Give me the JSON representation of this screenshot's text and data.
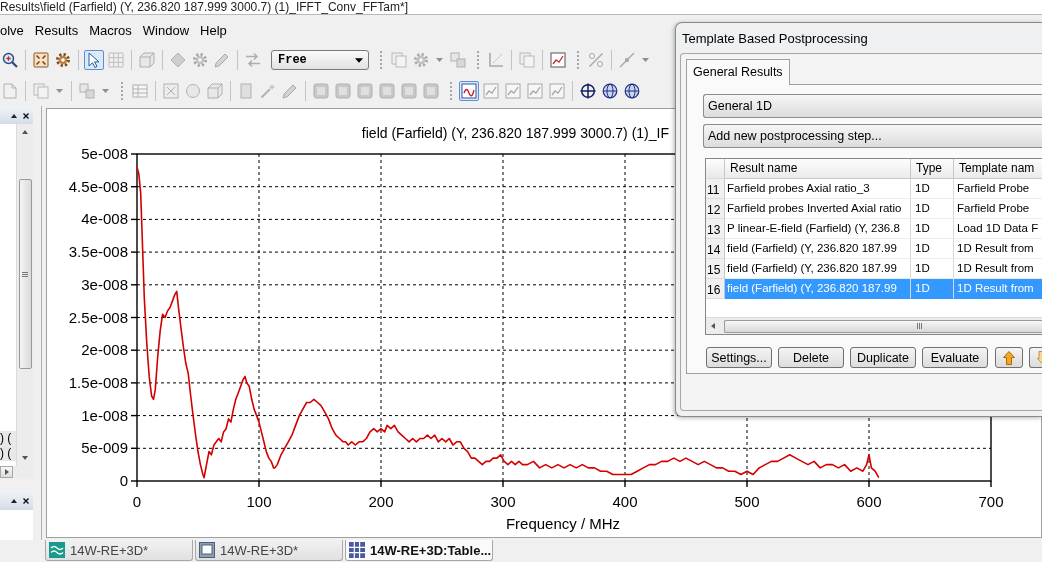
{
  "title_bar": {
    "title": "Results\\field (Farfield) (Y, 236.820 187.999 3000.7) (1)_IFFT_Conv_FFTam*]"
  },
  "menu": [
    "olve",
    "Results",
    "Macros",
    "Window",
    "Help"
  ],
  "toolbars": [
    [
      {
        "kind": "zoom",
        "disabled": false,
        "on": false
      },
      {
        "kind": "separator"
      },
      {
        "kind": "fit",
        "disabled": false,
        "on": false
      },
      {
        "kind": "wheel",
        "disabled": false,
        "on": false
      },
      {
        "kind": "separator"
      },
      {
        "kind": "pointer",
        "disabled": false,
        "on": true
      },
      {
        "kind": "grid",
        "disabled": true,
        "on": false
      },
      {
        "kind": "separator"
      },
      {
        "kind": "cube",
        "disabled": true,
        "on": false
      },
      {
        "kind": "separator"
      },
      {
        "kind": "diamond",
        "disabled": true,
        "on": false
      },
      {
        "kind": "wheel",
        "disabled": true,
        "on": false
      },
      {
        "kind": "pencil",
        "disabled": true,
        "on": false
      },
      {
        "kind": "separator"
      },
      {
        "kind": "arrows",
        "disabled": true,
        "on": false
      },
      {
        "kind": "dropdown",
        "value": "Free"
      },
      {
        "kind": "handle"
      },
      {
        "kind": "pages",
        "disabled": true,
        "on": false
      },
      {
        "kind": "wheel",
        "disabled": true,
        "on": false
      },
      {
        "kind": "caret",
        "disabled": true
      },
      {
        "kind": "squares",
        "disabled": true,
        "on": false
      },
      {
        "kind": "handle"
      },
      {
        "kind": "axes",
        "disabled": true,
        "on": false
      },
      {
        "kind": "separator"
      },
      {
        "kind": "pages",
        "disabled": true,
        "on": false
      },
      {
        "kind": "separator"
      },
      {
        "kind": "chart",
        "disabled": false,
        "on": false
      },
      {
        "kind": "handle"
      },
      {
        "kind": "percent",
        "disabled": true,
        "on": false
      },
      {
        "kind": "separator"
      },
      {
        "kind": "line",
        "disabled": true,
        "on": false
      },
      {
        "kind": "caret",
        "disabled": true
      }
    ],
    [
      {
        "kind": "page",
        "disabled": true,
        "on": false
      },
      {
        "kind": "separator"
      },
      {
        "kind": "pages",
        "disabled": true,
        "on": false
      },
      {
        "kind": "caret",
        "disabled": true
      },
      {
        "kind": "separator"
      },
      {
        "kind": "squares",
        "disabled": true,
        "on": false
      },
      {
        "kind": "caret",
        "disabled": true
      },
      {
        "kind": "handle"
      },
      {
        "kind": "table",
        "disabled": true,
        "on": false
      },
      {
        "kind": "separator"
      },
      {
        "kind": "crossed",
        "disabled": true,
        "on": false
      },
      {
        "kind": "circle",
        "disabled": true,
        "on": false
      },
      {
        "kind": "cube",
        "disabled": true,
        "on": false
      },
      {
        "kind": "separator"
      },
      {
        "kind": "rectangle",
        "disabled": true,
        "on": false
      },
      {
        "kind": "wand",
        "disabled": true,
        "on": false
      },
      {
        "kind": "pencil",
        "disabled": true,
        "on": false
      },
      {
        "kind": "separator"
      },
      {
        "kind": "tile",
        "disabled": true,
        "on": false
      },
      {
        "kind": "tile",
        "disabled": true,
        "on": false
      },
      {
        "kind": "tile",
        "disabled": true,
        "on": false
      },
      {
        "kind": "tile",
        "disabled": true,
        "on": false
      },
      {
        "kind": "tile",
        "disabled": true,
        "on": false
      },
      {
        "kind": "tile",
        "disabled": true,
        "on": false
      },
      {
        "kind": "handle"
      },
      {
        "kind": "wave",
        "disabled": false,
        "on": true
      },
      {
        "kind": "chart",
        "disabled": true,
        "on": false
      },
      {
        "kind": "chart",
        "disabled": true,
        "on": false
      },
      {
        "kind": "chart",
        "disabled": true,
        "on": false
      },
      {
        "kind": "chart",
        "disabled": true,
        "on": false
      },
      {
        "kind": "separator"
      },
      {
        "kind": "crosshair",
        "disabled": false,
        "on": false
      },
      {
        "kind": "globe",
        "disabled": false,
        "on": false
      },
      {
        "kind": "globe",
        "disabled": false,
        "on": false
      }
    ]
  ],
  "left_panel": {
    "items": [
      ") (",
      ") ("
    ]
  },
  "plot": {
    "chart_data": {
      "type": "line",
      "title": "field (Farfield) (Y, 236.820 187.999 3000.7) (1)_IF",
      "xlabel": "Frequency / MHz",
      "grid": true,
      "xlim": [
        0,
        700
      ],
      "ylim": [
        0,
        5e-08
      ],
      "xticks": [
        0,
        100,
        200,
        300,
        400,
        500,
        600,
        700
      ],
      "yticks": [
        {
          "value": 0,
          "label": "0"
        },
        {
          "value": 5e-09,
          "label": "5e-009"
        },
        {
          "value": 1e-08,
          "label": "1e-008"
        },
        {
          "value": 1.5e-08,
          "label": "1.5e-008"
        },
        {
          "value": 2e-08,
          "label": "2e-008"
        },
        {
          "value": 2.5e-08,
          "label": "2.5e-008"
        },
        {
          "value": 3e-08,
          "label": "3e-008"
        },
        {
          "value": 3.5e-08,
          "label": "3.5e-008"
        },
        {
          "value": 4e-08,
          "label": "4e-008"
        },
        {
          "value": 4.5e-08,
          "label": "4.5e-008"
        },
        {
          "value": 5e-08,
          "label": "5e-008"
        }
      ],
      "x": [
        0,
        1.5,
        3,
        4.5,
        6,
        8,
        10,
        12,
        13.5,
        15,
        17,
        19,
        21,
        23,
        25,
        27,
        29,
        31,
        32.5,
        34,
        36,
        38,
        40,
        42,
        44,
        46,
        48,
        50,
        52,
        54,
        55,
        57,
        59,
        61,
        63,
        65,
        67,
        69,
        71,
        73,
        75,
        77,
        79,
        81,
        83,
        85,
        87,
        88.5,
        90,
        92,
        94,
        96,
        98,
        100,
        102,
        104,
        106,
        108,
        110,
        112,
        113,
        115,
        118,
        121,
        124,
        127,
        130,
        133,
        136,
        139,
        142,
        145,
        148,
        151,
        154,
        157,
        160,
        163,
        166,
        169,
        171,
        173,
        176,
        179,
        182,
        185,
        188,
        191,
        194,
        197,
        200,
        203,
        205,
        208,
        211,
        214,
        217,
        220,
        223,
        226,
        229,
        232,
        235,
        238,
        241,
        244,
        247,
        250,
        253,
        256,
        259,
        262,
        265,
        268,
        271,
        274,
        277,
        280,
        283,
        286,
        289,
        292,
        295,
        298,
        301,
        304,
        307,
        310,
        313,
        316,
        320,
        325,
        330,
        335,
        340,
        345,
        350,
        355,
        360,
        365,
        370,
        375,
        380,
        385,
        390,
        395,
        400,
        405,
        410,
        415,
        420,
        425,
        430,
        435,
        440,
        445,
        450,
        455,
        460,
        465,
        470,
        475,
        480,
        485,
        490,
        495,
        500,
        505,
        510,
        515,
        520,
        525,
        530,
        535,
        540,
        545,
        550,
        555,
        560,
        565,
        570,
        575,
        580,
        585,
        590,
        595,
        598,
        600,
        602,
        605,
        608
      ],
      "series": [
        {
          "color": "#d40000",
          "values": [
            4.8e-08,
            4.7e-08,
            4.4e-08,
            3.6e-08,
            2.8e-08,
            2.1e-08,
            1.6e-08,
            1.3e-08,
            1.25e-08,
            1.4e-08,
            1.9e-08,
            2.3e-08,
            2.55e-08,
            2.5e-08,
            2.6e-08,
            2.65e-08,
            2.75e-08,
            2.85e-08,
            2.9e-08,
            2.65e-08,
            2.35e-08,
            2.05e-08,
            1.8e-08,
            1.65e-08,
            1.3e-08,
            1e-08,
            7e-09,
            4.5e-09,
            2.5e-09,
            1e-09,
            5e-10,
            2.5e-09,
            4.5e-09,
            4e-09,
            5.5e-09,
            6e-09,
            6.5e-09,
            6e-09,
            7.5e-09,
            8e-09,
            9.5e-09,
            9e-09,
            1.1e-08,
            1.25e-08,
            1.35e-08,
            1.45e-08,
            1.55e-08,
            1.6e-08,
            1.5e-08,
            1.45e-08,
            1.25e-08,
            1.1e-08,
            1e-08,
            9e-09,
            7.5e-09,
            6e-09,
            4.5e-09,
            3.5e-09,
            3e-09,
            2e-09,
            2e-09,
            2.5e-09,
            4e-09,
            5e-09,
            6e-09,
            7e-09,
            8.5e-09,
            1e-08,
            1.1e-08,
            1.2e-08,
            1.2e-08,
            1.25e-08,
            1.2e-08,
            1.15e-08,
            1.05e-08,
            9.5e-09,
            8e-09,
            7e-09,
            6.5e-09,
            6e-09,
            6e-09,
            5.5e-09,
            6e-09,
            5.5e-09,
            6e-09,
            6e-09,
            6.5e-09,
            7.5e-09,
            8e-09,
            7.5e-09,
            8e-09,
            7.5e-09,
            8.5e-09,
            8e-09,
            8.5e-09,
            7.5e-09,
            7e-09,
            6.5e-09,
            6e-09,
            6.5e-09,
            6e-09,
            6.5e-09,
            6.5e-09,
            7e-09,
            6.5e-09,
            7e-09,
            6e-09,
            6.5e-09,
            6e-09,
            6.5e-09,
            5.5e-09,
            6e-09,
            6e-09,
            5e-09,
            4.5e-09,
            3.5e-09,
            3.5e-09,
            3e-09,
            2.5e-09,
            3e-09,
            3e-09,
            3.5e-09,
            3.5e-09,
            4e-09,
            3e-09,
            2.5e-09,
            3e-09,
            2.5e-09,
            3e-09,
            2.5e-09,
            2.5e-09,
            3e-09,
            2e-09,
            2.5e-09,
            2e-09,
            2.5e-09,
            2e-09,
            2.5e-09,
            2e-09,
            2.5e-09,
            2e-09,
            2e-09,
            1.5e-09,
            1.5e-09,
            1e-09,
            1e-09,
            1e-09,
            1e-09,
            1.5e-09,
            2e-09,
            2.5e-09,
            2.5e-09,
            3e-09,
            3e-09,
            3.5e-09,
            3e-09,
            3.5e-09,
            3e-09,
            2.5e-09,
            3e-09,
            2.5e-09,
            2e-09,
            2e-09,
            1.5e-09,
            1.5e-09,
            1e-09,
            1.5e-09,
            1e-09,
            2e-09,
            2.5e-09,
            3e-09,
            3e-09,
            3.5e-09,
            4e-09,
            3.5e-09,
            3e-09,
            2.5e-09,
            3e-09,
            2e-09,
            2.5e-09,
            2.5e-09,
            2e-09,
            2.5e-09,
            1.5e-09,
            2e-09,
            1.5e-09,
            2.5e-09,
            4e-09,
            2e-09,
            1.5e-09,
            5e-10
          ]
        }
      ]
    }
  },
  "document_tabs": [
    {
      "label": "14W-RE+3D*",
      "kind": "wave",
      "selected": false
    },
    {
      "label": "14W-RE+3D*",
      "kind": "frame",
      "selected": false
    },
    {
      "label": "14W-RE+3D:Table...",
      "kind": "table",
      "selected": true
    }
  ],
  "dialog": {
    "title": "Template Based Postprocessing",
    "tabs": [
      {
        "label": "General Results",
        "selected": true
      }
    ],
    "category": "General 1D",
    "step": "Add new postprocessing step...",
    "table": {
      "columns": [
        "Result name",
        "Type",
        "Template nam"
      ],
      "rows": [
        {
          "number": "11",
          "cells": [
            "Farfield probes Axial ratio_3",
            "1D",
            "Farfield Probe"
          ],
          "selected": false
        },
        {
          "number": "12",
          "cells": [
            "Farfield probes Inverted Axial ratio",
            "1D",
            "Farfield Probe"
          ],
          "selected": false
        },
        {
          "number": "13",
          "cells": [
            "P linear-E-field (Farfield) (Y, 236.8",
            "1D",
            "Load 1D Data F"
          ],
          "selected": false
        },
        {
          "number": "14",
          "cells": [
            "field (Farfield) (Y, 236.820 187.99",
            "1D",
            "1D Result from"
          ],
          "selected": false
        },
        {
          "number": "15",
          "cells": [
            "field (Farfield) (Y, 236.820 187.99",
            "1D",
            "1D Result from"
          ],
          "selected": false
        },
        {
          "number": "16",
          "cells": [
            "field (Farfield) (Y, 236.820 187.99",
            "1D",
            "1D Result from"
          ],
          "selected": true
        }
      ]
    },
    "buttons": [
      "Settings...",
      "Delete",
      "Duplicate",
      "Evaluate"
    ]
  }
}
